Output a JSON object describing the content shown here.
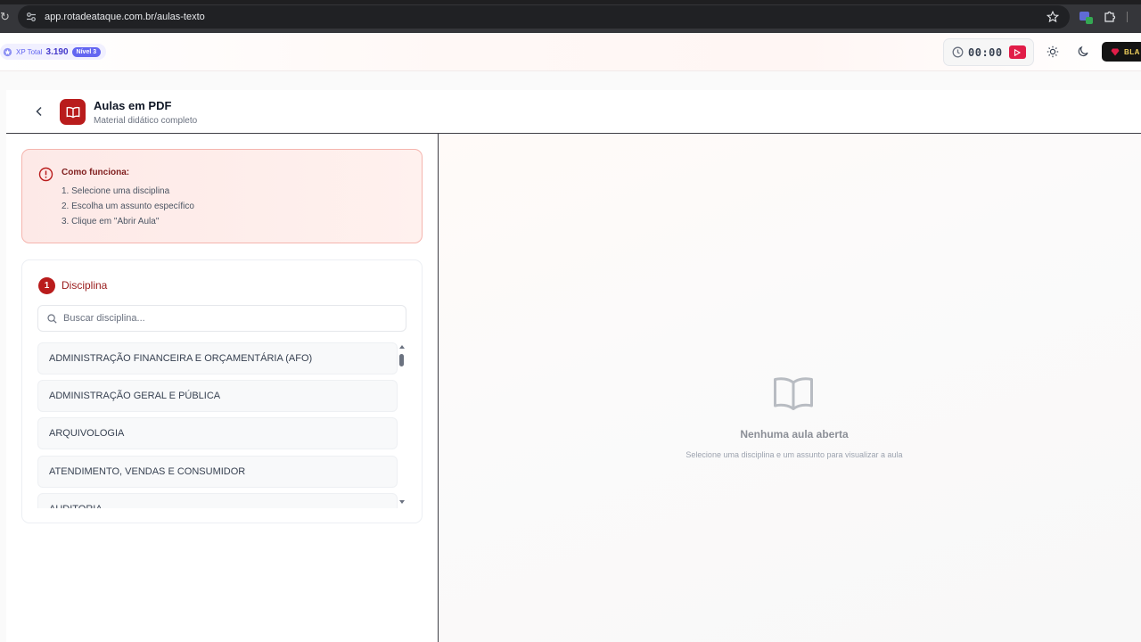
{
  "browser": {
    "url": "app.rotadeataque.com.br/aulas-texto"
  },
  "topbar": {
    "xp_label": "XP Total",
    "xp_value": "3.190",
    "level": "Nível 3",
    "timer": "00:00",
    "black_button": "BLA"
  },
  "header": {
    "title": "Aulas em PDF",
    "subtitle": "Material didático completo"
  },
  "howto": {
    "title": "Como funciona:",
    "steps": [
      "1. Selecione uma disciplina",
      "2. Escolha um assunto específico",
      "3. Clique em \"Abrir Aula\""
    ]
  },
  "disciplina": {
    "step_number": "1",
    "title": "Disciplina",
    "search_placeholder": "Buscar disciplina...",
    "items": [
      "ADMINISTRAÇÃO FINANCEIRA E ORÇAMENTÁRIA (AFO)",
      "ADMINISTRAÇÃO GERAL E PÚBLICA",
      "ARQUIVOLOGIA",
      "ATENDIMENTO, VENDAS E CONSUMIDOR",
      "AUDITORIA"
    ]
  },
  "empty_state": {
    "title": "Nenhuma aula aberta",
    "subtitle": "Selecione uma disciplina e um assunto para visualizar a aula"
  },
  "colors": {
    "brand_red": "#b91c1c",
    "xp_purple": "#6366f1"
  }
}
